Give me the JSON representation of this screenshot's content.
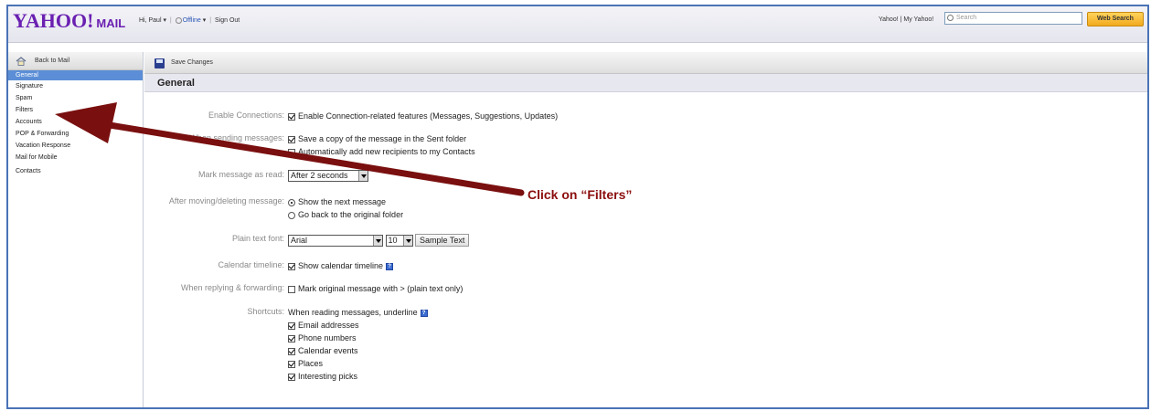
{
  "header": {
    "logo_main": "YAHOO!",
    "logo_suffix": "MAIL",
    "greeting": "Hi, Paul",
    "status": "Offline",
    "sign_out": "Sign Out",
    "links": "Yahoo! | My Yahoo!",
    "search_placeholder": "Search",
    "web_search": "Web Search"
  },
  "sidebar": {
    "back_label": "Back to Mail",
    "items": [
      {
        "label": "General",
        "active": true
      },
      {
        "label": "Signature"
      },
      {
        "label": "Spam"
      },
      {
        "label": "Filters"
      },
      {
        "label": "Accounts"
      },
      {
        "label": "POP & Forwarding"
      },
      {
        "label": "Vacation Response"
      },
      {
        "label": "Mail for Mobile"
      },
      {
        "label": "Contacts"
      }
    ]
  },
  "toolbar": {
    "save_label": "Save Changes"
  },
  "section": {
    "title": "General"
  },
  "settings": {
    "connections": {
      "label": "Enable Connections:",
      "option": "Enable Connection-related features (Messages, Suggestions, Updates)",
      "checked": true
    },
    "sending": {
      "label": "When sending messages:",
      "save_copy": "Save a copy of the message in the Sent folder",
      "auto_add": "Automatically add new recipients to my Contacts"
    },
    "mark_read": {
      "label": "Mark message as read:",
      "value": "After 2 seconds"
    },
    "after_move": {
      "label": "After moving/deleting message:",
      "opt_next": "Show the next message",
      "opt_back": "Go back to the original folder"
    },
    "font": {
      "label": "Plain text font:",
      "family": "Arial",
      "size": "10",
      "sample": "Sample Text"
    },
    "calendar": {
      "label": "Calendar timeline:",
      "option": "Show calendar timeline"
    },
    "replying": {
      "label": "When replying & forwarding:",
      "option": "Mark original message with > (plain text only)"
    },
    "shortcuts": {
      "label": "Shortcuts:",
      "intro": "When reading messages, underline",
      "items": [
        "Email addresses",
        "Phone numbers",
        "Calendar events",
        "Places",
        "Interesting picks"
      ]
    }
  },
  "annotation": {
    "text": "Click on “Filters”",
    "color": "#8b0d0d"
  }
}
